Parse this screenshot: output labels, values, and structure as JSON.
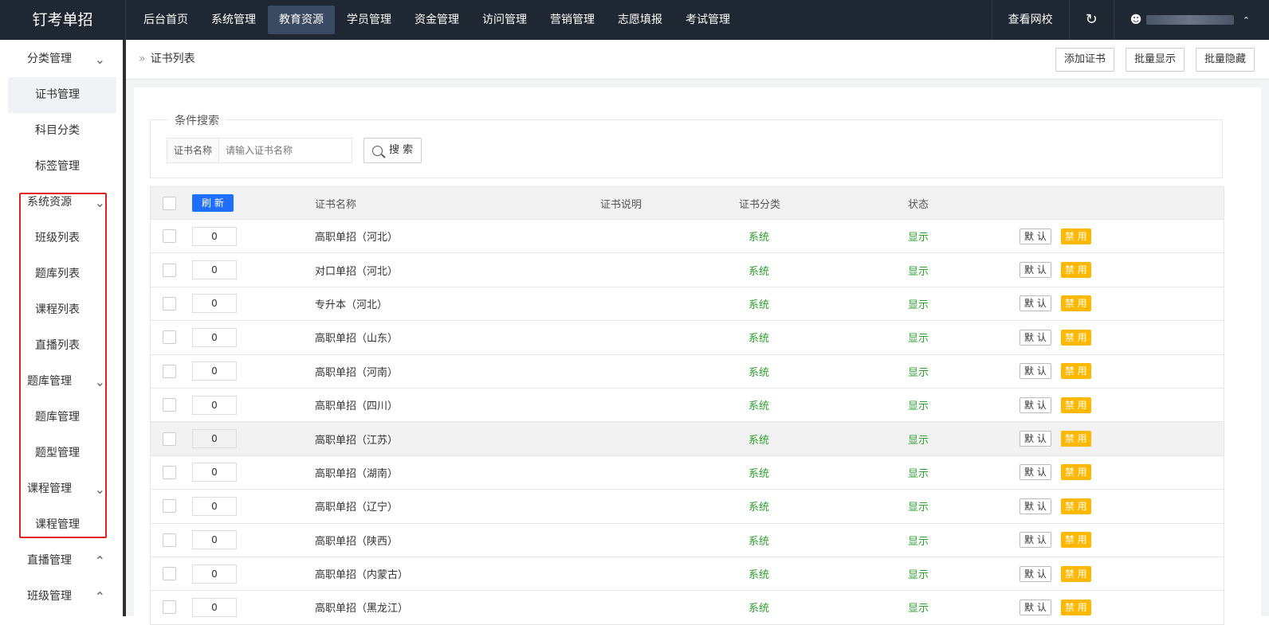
{
  "header": {
    "logo": "钉考单招",
    "nav": [
      "后台首页",
      "系统管理",
      "教育资源",
      "学员管理",
      "资金管理",
      "访问管理",
      "营销管理",
      "志愿填报",
      "考试管理"
    ],
    "active_nav": "教育资源",
    "view_site": "查看网校"
  },
  "sidebar": {
    "groups": [
      {
        "label": "分类管理",
        "items": [
          "证书管理",
          "科目分类",
          "标签管理"
        ],
        "chevron": "chevron-down-icon"
      },
      {
        "label": "系统资源",
        "items": [
          "班级列表",
          "题库列表",
          "课程列表",
          "直播列表"
        ],
        "chevron": "chevron-down-icon"
      },
      {
        "label": "题库管理",
        "items": [
          "题库管理",
          "题型管理"
        ],
        "chevron": "chevron-down-icon"
      },
      {
        "label": "课程管理",
        "items": [
          "课程管理"
        ],
        "chevron": "chevron-down-icon"
      },
      {
        "label": "直播管理",
        "items": [],
        "chevron": "chevron-up-icon"
      },
      {
        "label": "班级管理",
        "items": [],
        "chevron": "chevron-up-icon"
      }
    ],
    "active_item": "证书管理"
  },
  "breadcrumb": "证书列表",
  "actions": [
    "添加证书",
    "批量显示",
    "批量隐藏"
  ],
  "search": {
    "legend": "条件搜索",
    "label": "证书名称",
    "placeholder": "请输入证书名称",
    "button": "搜 索"
  },
  "table": {
    "refresh": "刷 新",
    "headers": {
      "name": "证书名称",
      "desc": "证书说明",
      "category": "证书分类",
      "status": "状态"
    },
    "rows": [
      {
        "sort": "0",
        "name": "高职单招（河北）",
        "category": "系统",
        "status": "显示"
      },
      {
        "sort": "0",
        "name": "对口单招（河北）",
        "category": "系统",
        "status": "显示"
      },
      {
        "sort": "0",
        "name": "专升本（河北）",
        "category": "系统",
        "status": "显示"
      },
      {
        "sort": "0",
        "name": "高职单招（山东）",
        "category": "系统",
        "status": "显示"
      },
      {
        "sort": "0",
        "name": "高职单招（河南）",
        "category": "系统",
        "status": "显示"
      },
      {
        "sort": "0",
        "name": "高职单招（四川）",
        "category": "系统",
        "status": "显示"
      },
      {
        "sort": "0",
        "name": "高职单招（江苏）",
        "category": "系统",
        "status": "显示"
      },
      {
        "sort": "0",
        "name": "高职单招（湖南）",
        "category": "系统",
        "status": "显示"
      },
      {
        "sort": "0",
        "name": "高职单招（辽宁）",
        "category": "系统",
        "status": "显示"
      },
      {
        "sort": "0",
        "name": "高职单招（陕西）",
        "category": "系统",
        "status": "显示"
      },
      {
        "sort": "0",
        "name": "高职单招（内蒙古）",
        "category": "系统",
        "status": "显示"
      },
      {
        "sort": "0",
        "name": "高职单招（黑龙江）",
        "category": "系统",
        "status": "显示"
      }
    ],
    "btn_default": "默 认",
    "btn_disable": "禁 用"
  },
  "colors": {
    "accent": "#1e6fff",
    "warning": "#ffb800",
    "success": "#2ba02b",
    "topbar": "#1f2733"
  }
}
